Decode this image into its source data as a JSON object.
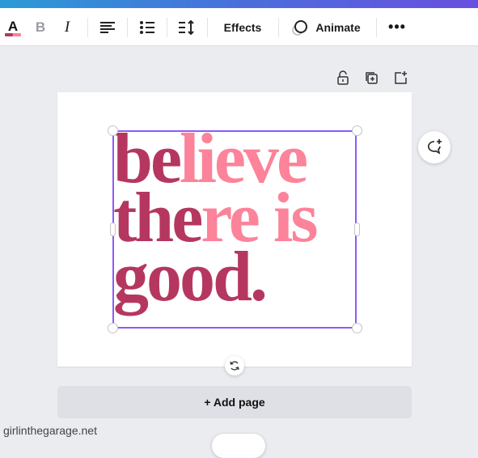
{
  "toolbar": {
    "effects_label": "Effects",
    "animate_label": "Animate",
    "text_color_colors": [
      "#b5375f",
      "#fc8399"
    ]
  },
  "canvas": {
    "lines": [
      [
        {
          "t": "be",
          "c": "dark"
        },
        {
          "t": "lieve",
          "c": "pink"
        }
      ],
      [
        {
          "t": "the",
          "c": "dark"
        },
        {
          "t": "re is",
          "c": "pink"
        }
      ],
      [
        {
          "t": "good.",
          "c": "dark"
        }
      ]
    ],
    "colors": {
      "dark": "#b5375f",
      "pink": "#fc8399",
      "selection": "#8b5cf6"
    }
  },
  "add_page_label": "+ Add page",
  "watermark": "girlinthegarage.net"
}
